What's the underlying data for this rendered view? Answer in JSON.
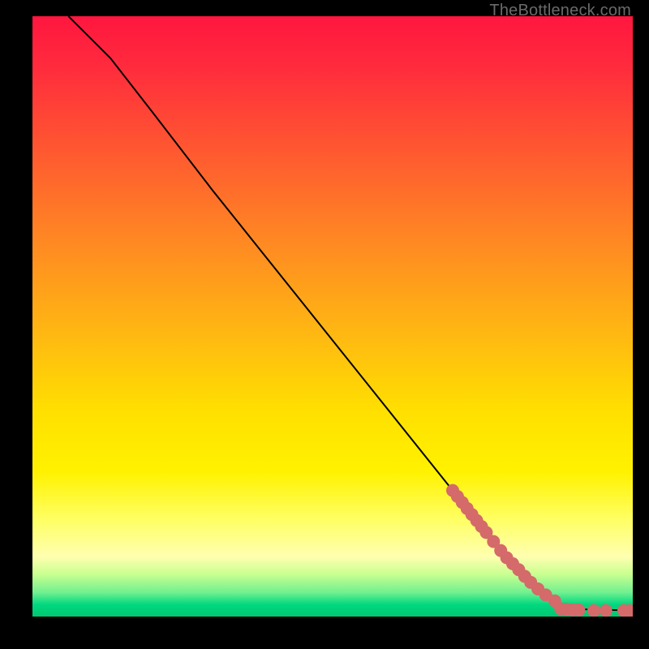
{
  "watermark": "TheBottleneck.com",
  "chart_data": {
    "type": "line",
    "title": "",
    "xlabel": "",
    "ylabel": "",
    "xlim": [
      0,
      100
    ],
    "ylim": [
      0,
      100
    ],
    "curve": {
      "name": "bottleneck-curve",
      "points": [
        {
          "x": 6.0,
          "y": 100.0
        },
        {
          "x": 9.0,
          "y": 97.0
        },
        {
          "x": 13.0,
          "y": 93.0
        },
        {
          "x": 20.0,
          "y": 84.0
        },
        {
          "x": 30.0,
          "y": 71.0
        },
        {
          "x": 40.0,
          "y": 58.5
        },
        {
          "x": 50.0,
          "y": 46.0
        },
        {
          "x": 60.0,
          "y": 33.5
        },
        {
          "x": 70.0,
          "y": 21.0
        },
        {
          "x": 78.0,
          "y": 11.0
        },
        {
          "x": 84.0,
          "y": 4.8
        },
        {
          "x": 88.0,
          "y": 2.2
        },
        {
          "x": 92.0,
          "y": 1.2
        },
        {
          "x": 100.0,
          "y": 1.0
        }
      ]
    },
    "scatter": {
      "name": "data-points",
      "color": "#d46a6a",
      "radius_px": 8,
      "points": [
        {
          "x": 70.0,
          "y": 21.0
        },
        {
          "x": 70.8,
          "y": 20.0
        },
        {
          "x": 71.6,
          "y": 19.0
        },
        {
          "x": 72.4,
          "y": 18.0
        },
        {
          "x": 73.2,
          "y": 17.0
        },
        {
          "x": 74.0,
          "y": 16.0
        },
        {
          "x": 74.8,
          "y": 15.0
        },
        {
          "x": 75.6,
          "y": 14.0
        },
        {
          "x": 76.8,
          "y": 12.5
        },
        {
          "x": 78.0,
          "y": 11.0
        },
        {
          "x": 79.0,
          "y": 9.8
        },
        {
          "x": 80.0,
          "y": 8.8
        },
        {
          "x": 81.0,
          "y": 7.8
        },
        {
          "x": 82.0,
          "y": 6.7
        },
        {
          "x": 83.0,
          "y": 5.7
        },
        {
          "x": 84.2,
          "y": 4.6
        },
        {
          "x": 85.5,
          "y": 3.6
        },
        {
          "x": 87.0,
          "y": 2.6
        },
        {
          "x": 88.0,
          "y": 1.3
        },
        {
          "x": 89.0,
          "y": 1.2
        },
        {
          "x": 90.0,
          "y": 1.1
        },
        {
          "x": 91.0,
          "y": 1.1
        },
        {
          "x": 93.5,
          "y": 1.0
        },
        {
          "x": 95.5,
          "y": 1.0
        },
        {
          "x": 98.5,
          "y": 1.0
        },
        {
          "x": 99.5,
          "y": 1.0
        }
      ]
    }
  }
}
